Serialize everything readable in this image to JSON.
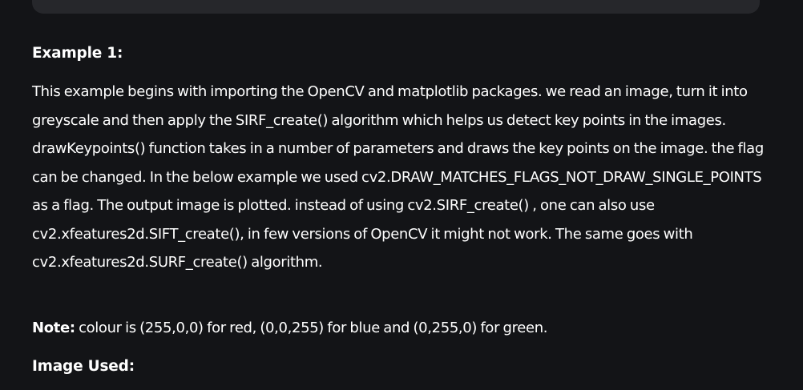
{
  "article": {
    "example_heading": "Example 1:",
    "description": "This example begins with importing the OpenCV and matplotlib packages. we read an image, turn it into greyscale and then apply the SIRF_create() algorithm which helps us detect key points in the images. drawKeypoints() function takes in a number of parameters and draws the key points on the image. the flag can be changed. In the below example we used cv2.DRAW_MATCHES_FLAGS_NOT_DRAW_SINGLE_POINTS as a flag. The output image is plotted. instead of using cv2.SIRF_create() , one can also use cv2.xfeatures2d.SIFT_create(), in few versions of OpenCV it might not work. The same goes with cv2.xfeatures2d.SURF_create() algorithm.",
    "note_label": "Note:",
    "note_text": " colour is (255,0,0) for red, (0,0,255) for blue and (0,255,0) for green.",
    "image_used_heading": "Image Used:"
  }
}
